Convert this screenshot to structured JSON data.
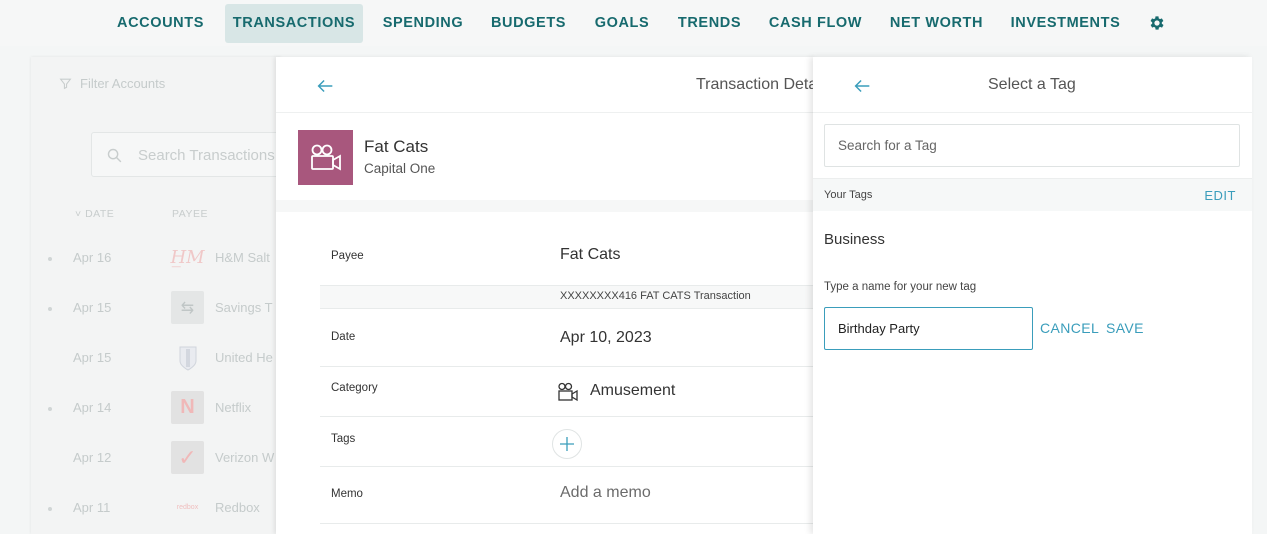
{
  "nav": {
    "items": [
      {
        "label": "ACCOUNTS"
      },
      {
        "label": "TRANSACTIONS"
      },
      {
        "label": "SPENDING"
      },
      {
        "label": "BUDGETS"
      },
      {
        "label": "GOALS"
      },
      {
        "label": "TRENDS"
      },
      {
        "label": "CASH FLOW"
      },
      {
        "label": "NET WORTH"
      },
      {
        "label": "INVESTMENTS"
      }
    ],
    "active": "TRANSACTIONS",
    "settings_icon": "gear-icon",
    "accent_color": "#176a6e"
  },
  "background_list": {
    "filter_label": "Filter Accounts",
    "search_placeholder": "Search Transactions",
    "columns": {
      "date": "DATE",
      "payee": "PAYEE"
    },
    "rows": [
      {
        "date": "Apr 16",
        "payee": "H&M Salt"
      },
      {
        "date": "Apr 15",
        "payee": "Savings T"
      },
      {
        "date": "Apr 15",
        "payee": "United He"
      },
      {
        "date": "Apr 14",
        "payee": "Netflix"
      },
      {
        "date": "Apr 12",
        "payee": "Verizon W"
      },
      {
        "date": "Apr 11",
        "payee": "Redbox"
      }
    ]
  },
  "detail": {
    "title": "Transaction Details",
    "merchant": {
      "name": "Fat Cats",
      "account": "Capital One",
      "logo_color": "#a8577d"
    },
    "fields": {
      "payee_label": "Payee",
      "payee_value": "Fat Cats",
      "description": "XXXXXXXX416 FAT CATS Transaction",
      "date_label": "Date",
      "date_value": "Apr 10, 2023",
      "category_label": "Category",
      "category_value": "Amusement",
      "tags_label": "Tags",
      "memo_label": "Memo",
      "memo_placeholder": "Add a memo"
    }
  },
  "tag_panel": {
    "title": "Select a Tag",
    "search_placeholder": "Search for a Tag",
    "your_tags_label": "Your Tags",
    "edit_label": "EDIT",
    "tags": [
      "Business"
    ],
    "new_tag_label": "Type a name for your new tag",
    "new_tag_value": "Birthday Party",
    "cancel_label": "CANCEL",
    "save_label": "SAVE",
    "link_color": "#3a9dbb"
  }
}
